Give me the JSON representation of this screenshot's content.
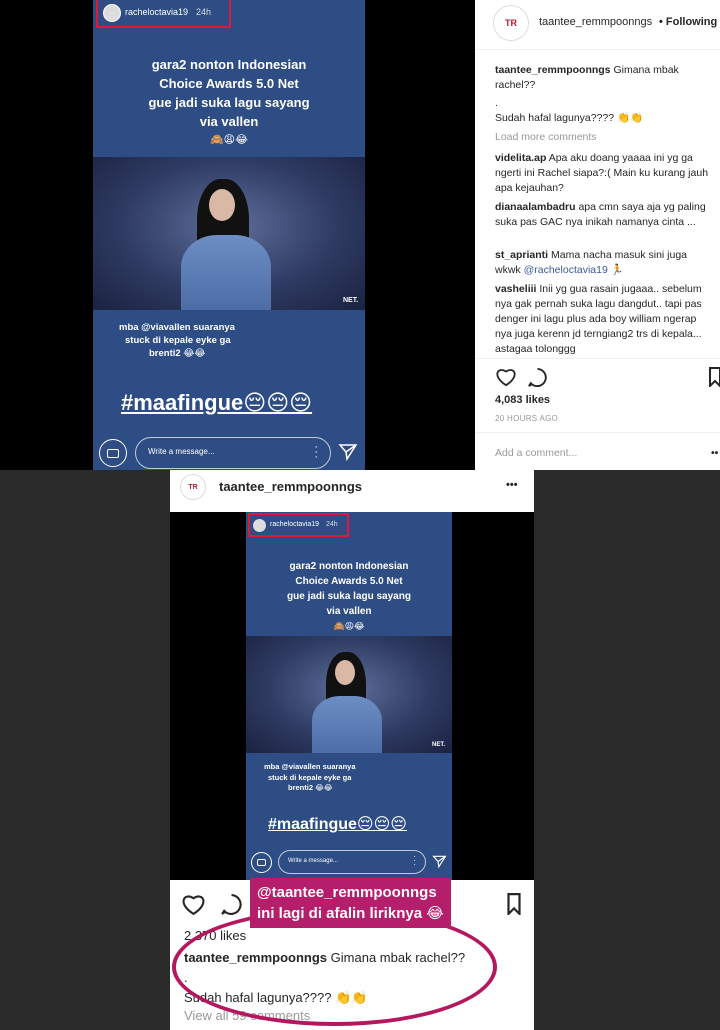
{
  "story": {
    "username": "racheloctavia19",
    "time": "24h",
    "caption_lines": [
      "gara2 nonton Indonesian",
      "Choice Awards 5.0 Net",
      "gue jadi suka lagu sayang",
      "via vallen"
    ],
    "caption_emoji": "🙈😩😂",
    "tv_logo": "NET.",
    "lower_lines": [
      "mba @viavallen suaranya",
      "stuck di kepale eyke ga",
      "brenti2 😂😂"
    ],
    "hashtag": "#maafingue😔😔😔",
    "message_placeholder": "Write a message..."
  },
  "post_panel": {
    "username": "taantee_remmpoonngs",
    "following": "• Following",
    "caption_user": "taantee_remmpoonngs",
    "caption_text": "Gimana mbak rachel??",
    "caption_dot": ".",
    "caption_text2": "Sudah hafal lagunya???? 👏👏",
    "load_more": "Load more comments",
    "comments": [
      {
        "user": "videlita.ap",
        "text": "Apa aku doang yaaaa ini yg ga ngerti ini Rachel siapa?:( Main ku kurang jauh apa kejauhan?"
      },
      {
        "user": "dianaalambadru",
        "text": "apa cmn saya aja yg paling suka pas GAC nya inikah namanya cinta ..."
      },
      {
        "user": "st_aprianti",
        "text": "Mama nacha masuk sini juga wkwk",
        "mention": "@racheloctavia19",
        "emoji": "🏃"
      },
      {
        "user": "vasheliii",
        "text": "Inii yg gua rasain jugaaa.. sebelum nya gak pernah suka lagu dangdut.. tapi pas denger ini lagu plus ada boy william ngerap nya juga kerenn jd terngiang2 trs di kepala... astagaa tolonggg"
      }
    ],
    "likes": "4,083 likes",
    "time_ago": "20 HOURS AGO",
    "add_comment": "Add a comment..."
  },
  "mobile_post": {
    "username": "taantee_remmpoonngs",
    "more": "•••",
    "likes": "2.370 likes",
    "caption_user": "taantee_remmpoonngs",
    "caption_text": "Gimana mbak rachel??",
    "caption_dot": ".",
    "caption_text2": "Sudah hafal lagunya???? 👏👏",
    "view_all": "View all 59 comments",
    "sticker_line1": "@taantee_remmpoonngs",
    "sticker_line2": "ini lagi di afalin liriknya 😂"
  },
  "colors": {
    "story_blue": "#2e4d84",
    "highlight": "#e0163d",
    "sticker": "#b51e6a"
  }
}
